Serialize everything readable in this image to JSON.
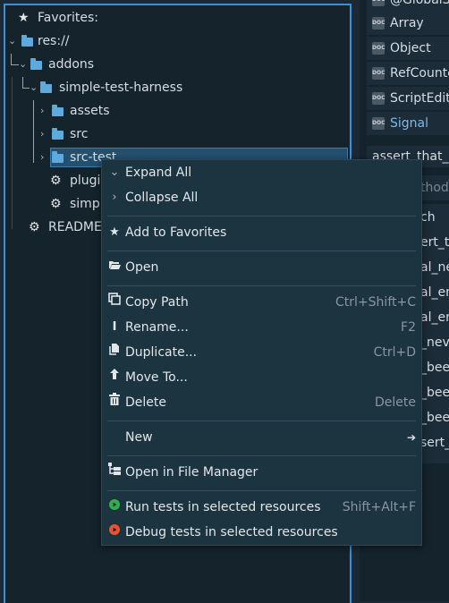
{
  "favorites_label": "Favorites:",
  "tree": {
    "res": "res://",
    "addons": "addons",
    "harness": "simple-test-harness",
    "assets": "assets",
    "src": "src",
    "src_test": "src-test",
    "plugin": "plugi",
    "simple": "simpl",
    "readme": "README"
  },
  "right_dock": {
    "top_partial": "@GlobalS",
    "items": [
      {
        "badge": "DOC",
        "label": "Array"
      },
      {
        "badge": "DOC",
        "label": "Object"
      },
      {
        "badge": "DOC",
        "label": "RefCounte"
      },
      {
        "badge": "DOC",
        "label": "ScriptEdito"
      },
      {
        "badge": "DOC",
        "label": "Signal"
      }
    ],
    "search_value": "assert_that_s",
    "filter_placeholder": "thod",
    "method_fragments": [
      "ch",
      "ert_th",
      "al_ne",
      "al_en",
      "al_en",
      "_neve",
      "_been",
      "_been",
      "_been",
      "sert_"
    ]
  },
  "context_menu": {
    "items": [
      {
        "icon": "chevron-down-icon",
        "label": "Expand All",
        "shortcut": ""
      },
      {
        "icon": "chevron-right-icon",
        "label": "Collapse All",
        "shortcut": ""
      },
      {
        "icon": "star-icon",
        "label": "Add to Favorites",
        "shortcut": ""
      },
      {
        "icon": "folder-open-icon",
        "label": "Open",
        "shortcut": ""
      },
      {
        "icon": "copy-icon",
        "label": "Copy Path",
        "shortcut": "Ctrl+Shift+C"
      },
      {
        "icon": "rename-icon",
        "label": "Rename...",
        "shortcut": "F2"
      },
      {
        "icon": "duplicate-icon",
        "label": "Duplicate...",
        "shortcut": "Ctrl+D"
      },
      {
        "icon": "move-icon",
        "label": "Move To...",
        "shortcut": ""
      },
      {
        "icon": "trash-icon",
        "label": "Delete",
        "shortcut": "Delete"
      },
      {
        "icon": "",
        "label": "New",
        "shortcut": ""
      },
      {
        "icon": "file-manager-icon",
        "label": "Open in File Manager",
        "shortcut": ""
      },
      {
        "icon": "run-icon",
        "label": "Run tests in selected resources",
        "shortcut": "Shift+Alt+F"
      },
      {
        "icon": "debug-icon",
        "label": "Debug tests in selected resources",
        "shortcut": ""
      }
    ]
  },
  "colors": {
    "accent": "#3c8ed6",
    "folder": "#5faadc",
    "run": "#2fb14a",
    "debug": "#e8552b",
    "link": "#7fb8e6"
  }
}
